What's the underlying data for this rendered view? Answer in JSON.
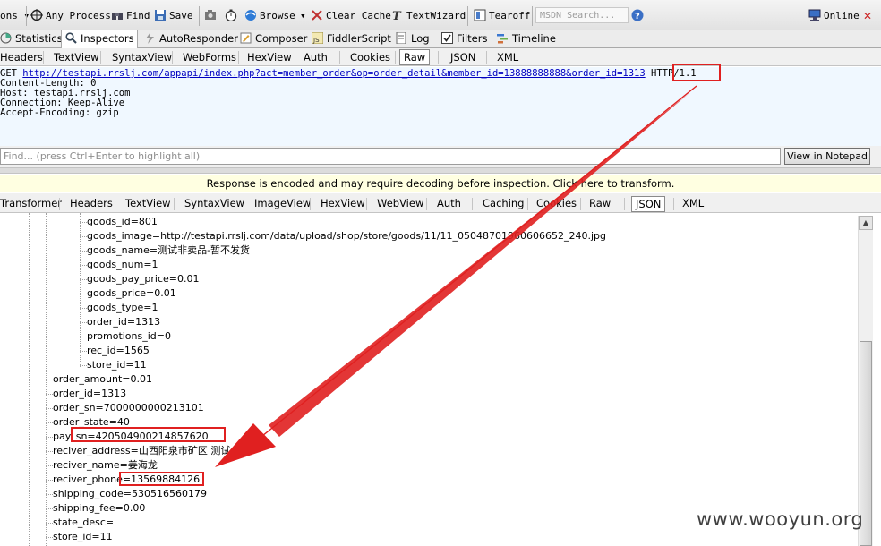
{
  "toolbar": {
    "process_filter": "ons ▾",
    "any_process": "Any Process",
    "find": "Find",
    "save": "Save",
    "browse": "Browse",
    "browse_arrow": "▾",
    "clear_cache": "Clear Cache",
    "textwizard": "TextWizard",
    "tearoff": "Tearoff",
    "msdn_placeholder": "MSDN Search...",
    "online": "Online",
    "close": "✕"
  },
  "main_tabs": [
    {
      "label": "Statistics"
    },
    {
      "label": "Inspectors"
    },
    {
      "label": "AutoResponder"
    },
    {
      "label": "Composer"
    },
    {
      "label": "FiddlerScript"
    },
    {
      "label": "Log"
    },
    {
      "label": "Filters"
    },
    {
      "label": "Timeline"
    }
  ],
  "request_tabs": [
    "Headers",
    "TextView",
    "SyntaxView",
    "WebForms",
    "HexView",
    "Auth",
    "Cookies",
    "Raw",
    "JSON",
    "XML"
  ],
  "request": {
    "method": "GET ",
    "url_part1": "http://testapi.rrslj.com/appapi/index.php?act=member_order&op=order_detail&member_id=13888888888&order_",
    "url_part2": "id=1313",
    "protocol": " HTTP/1.1",
    "headers": [
      "Content-Length: 0",
      "Host: testapi.rrslj.com",
      "Connection: Keep-Alive",
      "Accept-Encoding: gzip"
    ]
  },
  "find": {
    "placeholder": "Find... (press Ctrl+Enter to highlight all)",
    "notepad_button": "View in Notepad"
  },
  "notice": "Response is encoded and may require decoding before inspection. Click here to transform.",
  "response_tabs": [
    "Transformer",
    "Headers",
    "TextView",
    "SyntaxView",
    "ImageView",
    "HexView",
    "WebView",
    "Auth",
    "Caching",
    "Cookies",
    "Raw",
    "JSON",
    "XML"
  ],
  "active_response_tab": "JSON",
  "tree": {
    "goods": [
      "goods_id=801",
      "goods_image=http://testapi.rrslj.com/data/upload/shop/store/goods/11/11_05048701960606652_240.jpg",
      "goods_name=测试非卖品-暂不发货",
      "goods_num=1",
      "goods_pay_price=0.01",
      "goods_price=0.01",
      "goods_type=1",
      "order_id=1313",
      "promotions_id=0",
      "rec_id=1565",
      "store_id=11"
    ],
    "order": [
      "order_amount=0.01",
      "order_id=1313",
      "order_sn=7000000000213101",
      "order_state=40",
      "pay_sn=420504900214857620",
      "reciver_address=山西阳泉市矿区 测试 4",
      "reciver_name=姜海龙",
      "reciver_phone=13569884126",
      "shipping_code=530516560179",
      "shipping_fee=0.00",
      "state_desc=",
      "store_id=11"
    ]
  },
  "scrollbar": {
    "up": "▲",
    "down": "▼"
  },
  "annotation_color": "#e02020",
  "watermark": "www.wooyun.org"
}
